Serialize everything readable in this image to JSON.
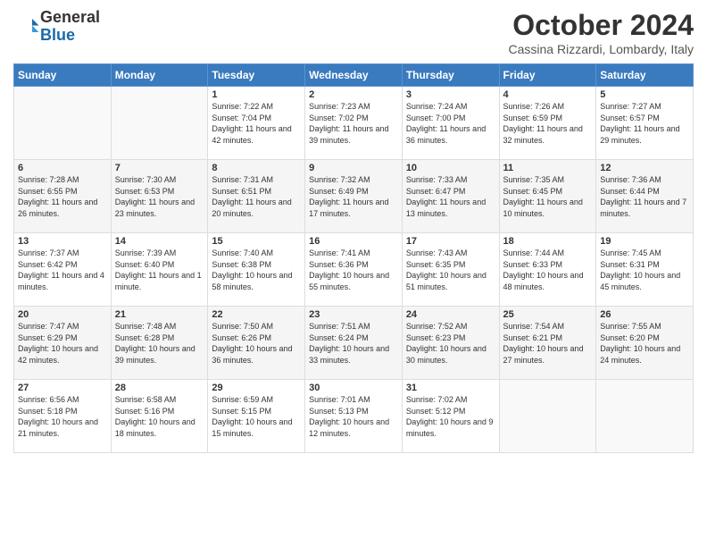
{
  "logo": {
    "general": "General",
    "blue": "Blue"
  },
  "header": {
    "title": "October 2024",
    "subtitle": "Cassina Rizzardi, Lombardy, Italy"
  },
  "weekdays": [
    "Sunday",
    "Monday",
    "Tuesday",
    "Wednesday",
    "Thursday",
    "Friday",
    "Saturday"
  ],
  "weeks": [
    [
      {
        "day": "",
        "info": ""
      },
      {
        "day": "",
        "info": ""
      },
      {
        "day": "1",
        "info": "Sunrise: 7:22 AM\nSunset: 7:04 PM\nDaylight: 11 hours and 42 minutes."
      },
      {
        "day": "2",
        "info": "Sunrise: 7:23 AM\nSunset: 7:02 PM\nDaylight: 11 hours and 39 minutes."
      },
      {
        "day": "3",
        "info": "Sunrise: 7:24 AM\nSunset: 7:00 PM\nDaylight: 11 hours and 36 minutes."
      },
      {
        "day": "4",
        "info": "Sunrise: 7:26 AM\nSunset: 6:59 PM\nDaylight: 11 hours and 32 minutes."
      },
      {
        "day": "5",
        "info": "Sunrise: 7:27 AM\nSunset: 6:57 PM\nDaylight: 11 hours and 29 minutes."
      }
    ],
    [
      {
        "day": "6",
        "info": "Sunrise: 7:28 AM\nSunset: 6:55 PM\nDaylight: 11 hours and 26 minutes."
      },
      {
        "day": "7",
        "info": "Sunrise: 7:30 AM\nSunset: 6:53 PM\nDaylight: 11 hours and 23 minutes."
      },
      {
        "day": "8",
        "info": "Sunrise: 7:31 AM\nSunset: 6:51 PM\nDaylight: 11 hours and 20 minutes."
      },
      {
        "day": "9",
        "info": "Sunrise: 7:32 AM\nSunset: 6:49 PM\nDaylight: 11 hours and 17 minutes."
      },
      {
        "day": "10",
        "info": "Sunrise: 7:33 AM\nSunset: 6:47 PM\nDaylight: 11 hours and 13 minutes."
      },
      {
        "day": "11",
        "info": "Sunrise: 7:35 AM\nSunset: 6:45 PM\nDaylight: 11 hours and 10 minutes."
      },
      {
        "day": "12",
        "info": "Sunrise: 7:36 AM\nSunset: 6:44 PM\nDaylight: 11 hours and 7 minutes."
      }
    ],
    [
      {
        "day": "13",
        "info": "Sunrise: 7:37 AM\nSunset: 6:42 PM\nDaylight: 11 hours and 4 minutes."
      },
      {
        "day": "14",
        "info": "Sunrise: 7:39 AM\nSunset: 6:40 PM\nDaylight: 11 hours and 1 minute."
      },
      {
        "day": "15",
        "info": "Sunrise: 7:40 AM\nSunset: 6:38 PM\nDaylight: 10 hours and 58 minutes."
      },
      {
        "day": "16",
        "info": "Sunrise: 7:41 AM\nSunset: 6:36 PM\nDaylight: 10 hours and 55 minutes."
      },
      {
        "day": "17",
        "info": "Sunrise: 7:43 AM\nSunset: 6:35 PM\nDaylight: 10 hours and 51 minutes."
      },
      {
        "day": "18",
        "info": "Sunrise: 7:44 AM\nSunset: 6:33 PM\nDaylight: 10 hours and 48 minutes."
      },
      {
        "day": "19",
        "info": "Sunrise: 7:45 AM\nSunset: 6:31 PM\nDaylight: 10 hours and 45 minutes."
      }
    ],
    [
      {
        "day": "20",
        "info": "Sunrise: 7:47 AM\nSunset: 6:29 PM\nDaylight: 10 hours and 42 minutes."
      },
      {
        "day": "21",
        "info": "Sunrise: 7:48 AM\nSunset: 6:28 PM\nDaylight: 10 hours and 39 minutes."
      },
      {
        "day": "22",
        "info": "Sunrise: 7:50 AM\nSunset: 6:26 PM\nDaylight: 10 hours and 36 minutes."
      },
      {
        "day": "23",
        "info": "Sunrise: 7:51 AM\nSunset: 6:24 PM\nDaylight: 10 hours and 33 minutes."
      },
      {
        "day": "24",
        "info": "Sunrise: 7:52 AM\nSunset: 6:23 PM\nDaylight: 10 hours and 30 minutes."
      },
      {
        "day": "25",
        "info": "Sunrise: 7:54 AM\nSunset: 6:21 PM\nDaylight: 10 hours and 27 minutes."
      },
      {
        "day": "26",
        "info": "Sunrise: 7:55 AM\nSunset: 6:20 PM\nDaylight: 10 hours and 24 minutes."
      }
    ],
    [
      {
        "day": "27",
        "info": "Sunrise: 6:56 AM\nSunset: 5:18 PM\nDaylight: 10 hours and 21 minutes."
      },
      {
        "day": "28",
        "info": "Sunrise: 6:58 AM\nSunset: 5:16 PM\nDaylight: 10 hours and 18 minutes."
      },
      {
        "day": "29",
        "info": "Sunrise: 6:59 AM\nSunset: 5:15 PM\nDaylight: 10 hours and 15 minutes."
      },
      {
        "day": "30",
        "info": "Sunrise: 7:01 AM\nSunset: 5:13 PM\nDaylight: 10 hours and 12 minutes."
      },
      {
        "day": "31",
        "info": "Sunrise: 7:02 AM\nSunset: 5:12 PM\nDaylight: 10 hours and 9 minutes."
      },
      {
        "day": "",
        "info": ""
      },
      {
        "day": "",
        "info": ""
      }
    ]
  ]
}
